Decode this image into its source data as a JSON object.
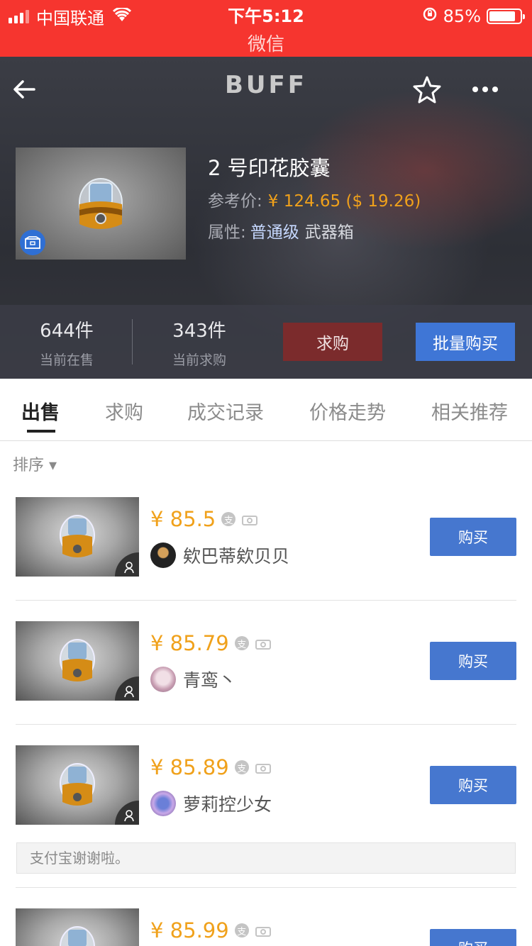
{
  "status_bar": {
    "carrier": "中国联通",
    "time": "下午5:12",
    "battery": "85%",
    "battery_level": 0.85,
    "app_title": "微信",
    "color": "#f6352f"
  },
  "header": {
    "logo": "BUFF",
    "back_icon": "back-arrow-icon",
    "star_icon": "star-icon",
    "more_icon": "more-icon"
  },
  "item": {
    "name": "2 号印花胶囊",
    "ref_label": "参考价:",
    "ref_price": "¥ 124.65 ($ 19.26)",
    "attr_label": "属性:",
    "attr_quality": "普通级",
    "attr_type": "武器箱"
  },
  "stats": {
    "on_sale_count": "644件",
    "on_sale_label": "当前在售",
    "buy_orders_count": "343件",
    "buy_orders_label": "当前求购",
    "want_button": "求购",
    "bulk_buy_button": "批量购买"
  },
  "tabs": [
    "出售",
    "求购",
    "成交记录",
    "价格走势",
    "相关推荐"
  ],
  "sort_label": "排序 ▾",
  "listings": [
    {
      "price": "¥ 85.5",
      "seller": "欸巴蒂欸贝贝",
      "buy_label": "购买"
    },
    {
      "price": "¥ 85.79",
      "seller": "青鸾丶",
      "buy_label": "购买"
    },
    {
      "price": "¥ 85.89",
      "seller": "萝莉控少女",
      "buy_label": "购买",
      "note": "支付宝谢谢啦。"
    },
    {
      "price": "¥ 85.99",
      "seller": "",
      "buy_label": "购买"
    }
  ],
  "colors": {
    "accent_price": "#f0a11b",
    "buy_button": "#4677cf",
    "want_button": "#7b2b2c"
  }
}
